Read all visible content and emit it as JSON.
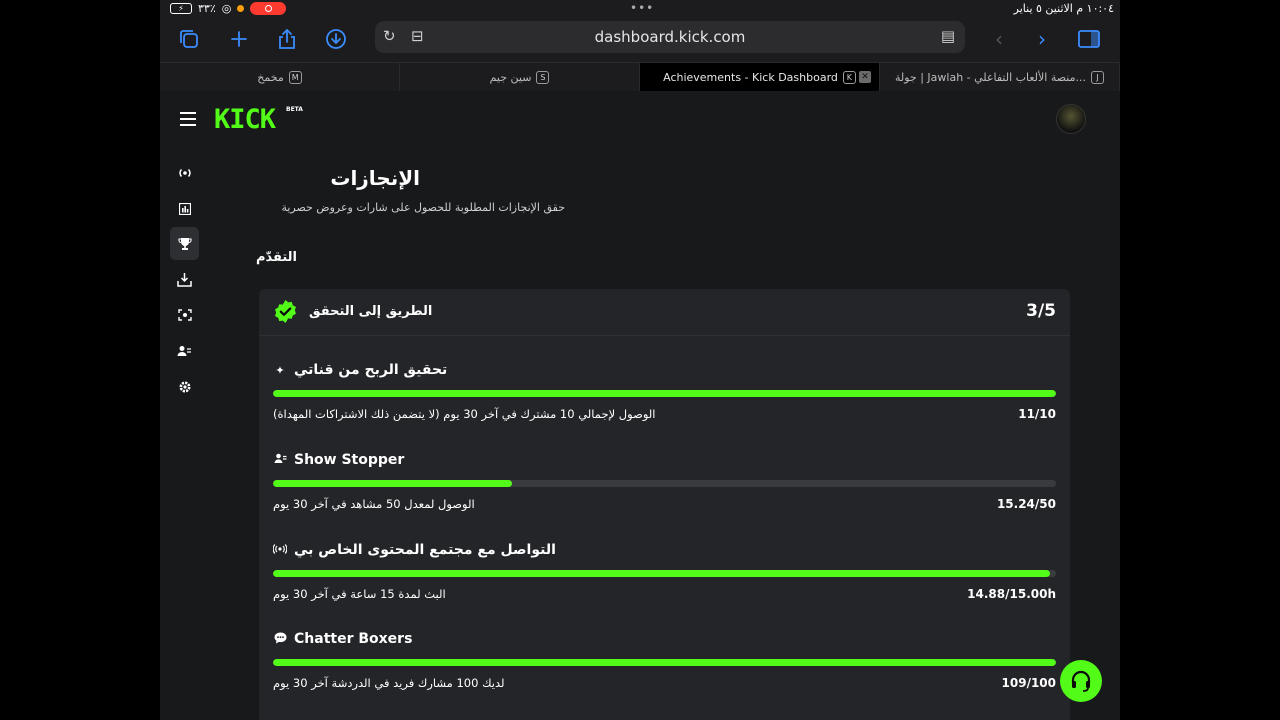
{
  "status_bar": {
    "battery": "٣٣٪",
    "datetime": "١٠:٠٤ م  الاثنين ٥ يناير"
  },
  "browser": {
    "url": "dashboard.kick.com",
    "icons": [
      "tabs-overview-icon",
      "new-tab-icon",
      "share-icon",
      "download-icon",
      "reload-icon",
      "extensions-icon",
      "reader-icon",
      "back-icon",
      "forward-icon",
      "sidebar-icon"
    ],
    "tabs": [
      {
        "label": "مخمخ",
        "badge": "M"
      },
      {
        "label": "سين جيم",
        "badge": "S"
      },
      {
        "label": "Achievements - Kick Dashboard",
        "badge": "K",
        "active": true
      },
      {
        "label": "جولة | Jawlah - منصة الألعاب التفاعلي...",
        "badge": "J"
      }
    ]
  },
  "app": {
    "logo": "KICK",
    "beta": "BETA",
    "accent": "#53fc18"
  },
  "page": {
    "title": "الإنجازات",
    "subtitle": "حقق الإنجازات المطلوبة للحصول على شارات وعروض حصرية",
    "section": "التقدّم"
  },
  "card": {
    "title": "الطريق إلى التحقق",
    "count": "3/5",
    "achievements": [
      {
        "name": "تحقيق الربح من قناتي",
        "icon": "sparkle-icon",
        "desc": "الوصول لإجمالي 10 مشترك في آخر 30 يوم (لا يتضمن ذلك الاشتراكات المهداة)",
        "value": "11/10",
        "progress": 1.0
      },
      {
        "name": "Show Stopper",
        "icon": "users-icon",
        "desc": "الوصول لمعدل 50 مشاهد في آخر 30 يوم",
        "value": "15.24/50",
        "progress": 0.3048
      },
      {
        "name": "التواصل مع مجتمع المحتوى الخاص بي",
        "icon": "broadcast-icon",
        "desc": "البث لمدة 15 ساعة في آخر 30 يوم",
        "value": "14.88/15.00h",
        "progress": 0.992
      },
      {
        "name": "Chatter Boxers",
        "icon": "chat-icon",
        "desc": "لديك 100 مشارك فريد في الدردشة آخر 30 يوم",
        "value": "109/100",
        "progress": 1.0
      }
    ]
  }
}
